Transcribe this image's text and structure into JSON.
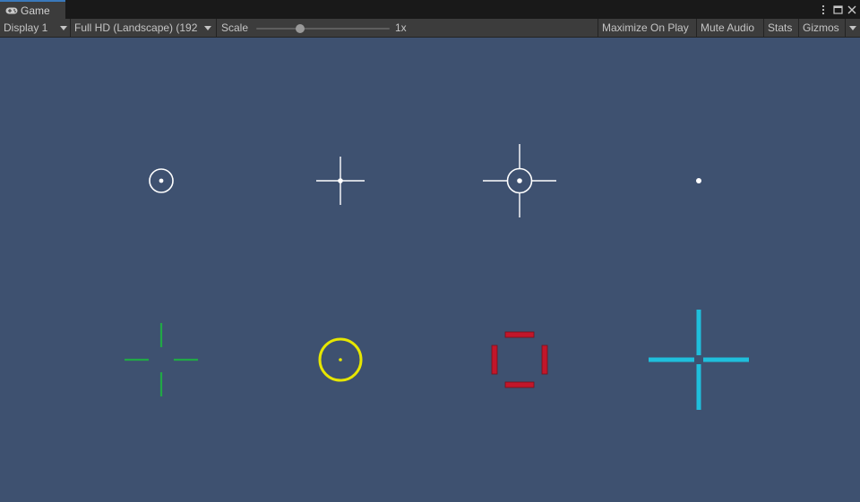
{
  "window": {
    "tab_title": "Game",
    "tab_icon": "gamepad-icon"
  },
  "toolbar": {
    "display": "Display 1",
    "resolution": "Full HD (Landscape) (192",
    "scale_label": "Scale",
    "scale_value_text": "1x",
    "scale_fraction": 0.33,
    "maximize_on_play": "Maximize On Play",
    "mute_audio": "Mute Audio",
    "stats": "Stats",
    "gizmos": "Gizmos"
  },
  "viewport": {
    "background": "#3e5170"
  },
  "crosshairs": [
    {
      "name": "circle-dot",
      "color": "#ffffff"
    },
    {
      "name": "cross-dot",
      "color": "#ffffff"
    },
    {
      "name": "cross-circle-dot",
      "color": "#ffffff"
    },
    {
      "name": "dot",
      "color": "#ffffff"
    },
    {
      "name": "gap-cross",
      "color": "#21a846"
    },
    {
      "name": "circle-dot",
      "color": "#e6e600"
    },
    {
      "name": "bracket-square",
      "color": "#c2162a"
    },
    {
      "name": "thick-cross",
      "color": "#1fbfdc"
    }
  ]
}
